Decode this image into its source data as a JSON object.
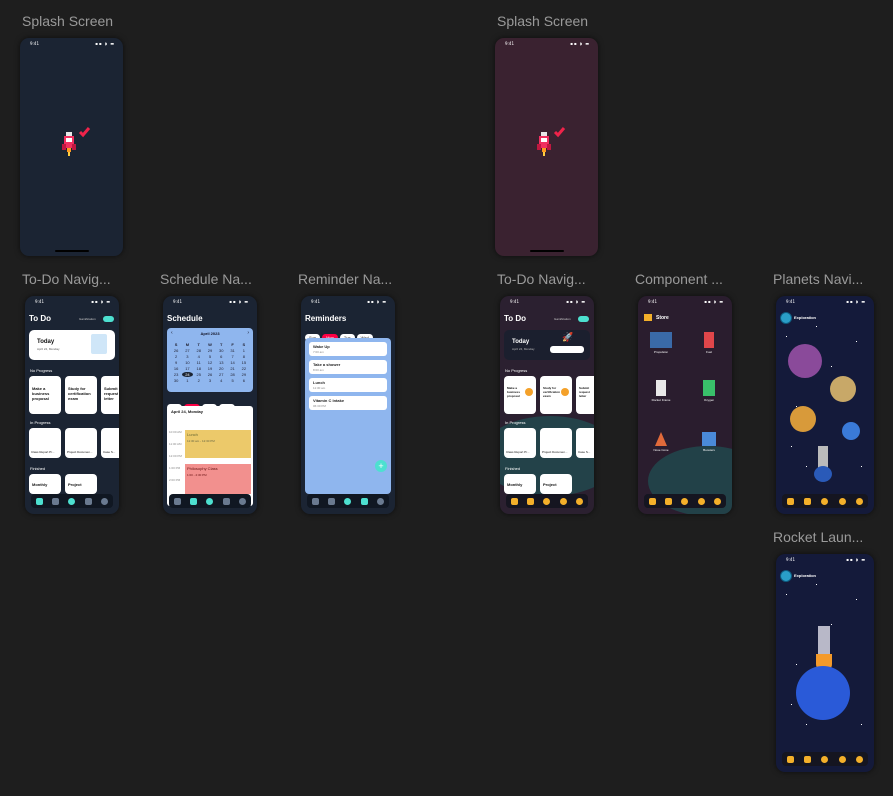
{
  "frames": [
    {
      "label": "Splash Screen"
    },
    {
      "label": "Splash Screen"
    },
    {
      "label": "To-Do Navig..."
    },
    {
      "label": "Schedule Na..."
    },
    {
      "label": "Reminder Na..."
    },
    {
      "label": "To-Do Navig..."
    },
    {
      "label": "Component ..."
    },
    {
      "label": "Planets Navi..."
    },
    {
      "label": "Rocket Laun..."
    }
  ],
  "status_time": "9:41",
  "todo": {
    "title": "To Do",
    "toggle_label": "Gamification",
    "today_title": "Today",
    "today_date": "April 24, Monday",
    "section_progress": "No Progress",
    "section_in_progress": "In Progress",
    "section_finished": "Finished",
    "cards_no_progress": [
      "Make a business proposal",
      "Study for certification exam",
      "Submit request letter"
    ],
    "cards_in_progress": [
      "Class Report Pr...",
      "Project Documen...",
      "Case S..."
    ],
    "cards_finished": [
      "Monthly",
      "Project"
    ]
  },
  "schedule": {
    "title": "Schedule",
    "month": "April 2023",
    "weekdays": [
      "S",
      "M",
      "T",
      "W",
      "T",
      "F",
      "S"
    ],
    "days": [
      "26",
      "27",
      "28",
      "29",
      "30",
      "31",
      "1",
      "2",
      "3",
      "4",
      "5",
      "6",
      "7",
      "8",
      "9",
      "10",
      "11",
      "12",
      "13",
      "14",
      "15",
      "16",
      "17",
      "18",
      "19",
      "20",
      "21",
      "22",
      "23",
      "24",
      "25",
      "26",
      "27",
      "28",
      "29",
      "30",
      "1",
      "2",
      "3",
      "4",
      "5",
      "6"
    ],
    "date_header": "April 24, Monday",
    "event_lunch": "Lunch",
    "event_lunch_time": "11:30 am - 12:30 PM",
    "event_philosophy": "Philosophy Class",
    "event_philosophy_time": "1:00 - 2:30 PM",
    "times": [
      "10:00 AM",
      "11:00 AM",
      "12:00 PM",
      "1:00 PM",
      "2:00 PM"
    ],
    "filters": [
      "Sun",
      "Mon",
      "Tue",
      "Wed",
      "Thu"
    ]
  },
  "reminders": {
    "title": "Reminders",
    "filters": [
      "Sun",
      "Mon",
      "Tue",
      "Wed",
      "Thu"
    ],
    "items": [
      {
        "title": "Wake Up",
        "time": "7:00 am"
      },
      {
        "title": "Take a shower",
        "time": "8:00 am"
      },
      {
        "title": "Lunch",
        "time": "11:30 am"
      },
      {
        "title": "Vitamin C Intake",
        "time": "06:30 PM"
      }
    ]
  },
  "store": {
    "title": "Store",
    "items": [
      "Propulsion",
      "Fuel",
      "Rocket Frame",
      "Oxygen",
      "Nose Cone",
      "Boosters"
    ]
  },
  "exploration": {
    "title": "Exploration"
  },
  "colors": {
    "canvas": "#1e1e1e",
    "label": "#9a9a9a",
    "navy": "#1b2433",
    "maroon": "#3a2230",
    "accent_teal": "#4de0d0",
    "accent_red": "#f0234a",
    "space": "#141a3a"
  }
}
